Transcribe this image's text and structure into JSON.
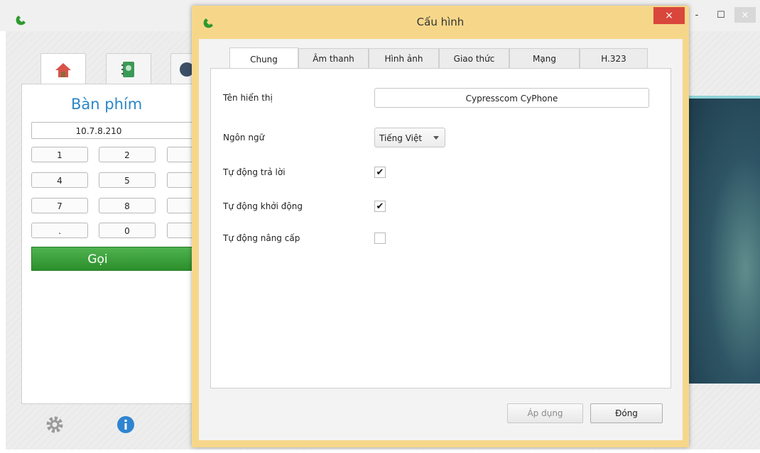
{
  "main_window": {
    "keypad_title": "Bàn phím",
    "number_value": "10.7.8.210",
    "keys": [
      "1",
      "2",
      "4",
      "5",
      "7",
      "8",
      ".",
      "0"
    ],
    "call_label": "Gọi",
    "tabs": [
      "home-icon",
      "contacts-icon",
      "history-icon"
    ],
    "controls": {
      "minimize": "-",
      "maximize": "☐",
      "close": "×"
    }
  },
  "dialog": {
    "title": "Cấu hình",
    "close": "×",
    "tabs": [
      "Chung",
      "Âm thanh",
      "Hình ảnh",
      "Giao thức",
      "Mạng",
      "H.323"
    ],
    "active_tab": "Chung",
    "form": {
      "display_name_label": "Tên hiển thị",
      "display_name_value": "Cypresscom CyPhone",
      "language_label": "Ngôn ngữ",
      "language_value": "Tiếng Việt",
      "auto_answer_label": "Tự động trả lời",
      "auto_answer_checked": "✔",
      "auto_start_label": "Tự động khởi động",
      "auto_start_checked": "✔",
      "auto_update_label": "Tự động nâng cấp"
    },
    "buttons": {
      "apply": "Áp dụng",
      "close": "Đóng"
    }
  },
  "colors": {
    "accent_blue": "#2a86c8",
    "call_green": "#3aa33a",
    "dialog_frame": "#f6d78a",
    "close_red": "#d9463b"
  }
}
